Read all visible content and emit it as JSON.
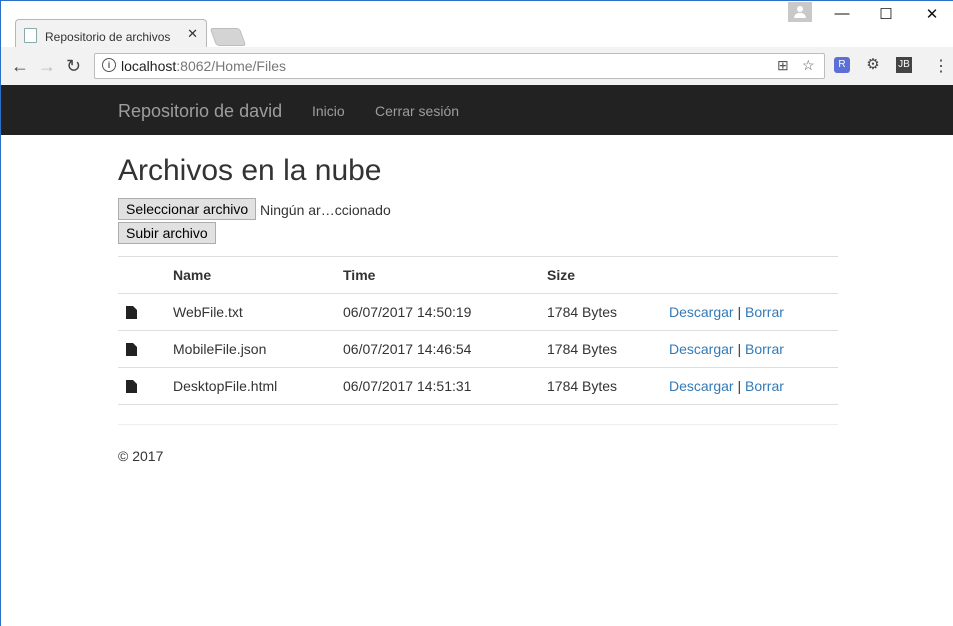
{
  "browser": {
    "tab_title": "Repositorio de archivos",
    "tab_close": "✕",
    "url_host": "localhost",
    "url_rest": ":8062/Home/Files",
    "window_controls": {
      "minimize": "—",
      "maximize": "☐",
      "close": "✕"
    },
    "icons": [
      "back-icon",
      "forward-icon",
      "reload-icon",
      "info-icon",
      "translate-icon",
      "star-icon",
      "menu-icon"
    ]
  },
  "navbar": {
    "brand": "Repositorio de david",
    "links": [
      {
        "label": "Inicio"
      },
      {
        "label": "Cerrar sesión"
      }
    ]
  },
  "main": {
    "title": "Archivos en la nube",
    "file_button_label": "Seleccionar archivo",
    "file_status": "Ningún ar…ccionado",
    "upload_button_label": "Subir archivo",
    "table": {
      "headers": [
        "Name",
        "Time",
        "Size"
      ],
      "rows": [
        {
          "name": "WebFile.txt",
          "time": "06/07/2017 14:50:19",
          "size": "1784 Bytes"
        },
        {
          "name": "MobileFile.json",
          "time": "06/07/2017 14:46:54",
          "size": "1784 Bytes"
        },
        {
          "name": "DesktopFile.html",
          "time": "06/07/2017 14:51:31",
          "size": "1784 Bytes"
        }
      ],
      "download_label": "Descargar",
      "separator": "|",
      "delete_label": "Borrar"
    }
  },
  "footer": {
    "text": "© 2017"
  },
  "colors": {
    "navbar_bg": "#222222",
    "link": "#337ab7",
    "nav_text": "#9d9d9d"
  }
}
